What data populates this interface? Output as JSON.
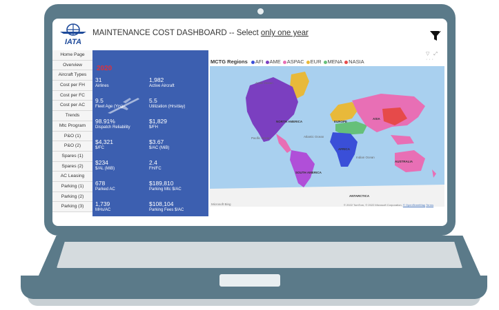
{
  "header": {
    "logo_text": "IATA",
    "title_prefix": "MAINTENANCE COST DASHBOARD -- Select ",
    "title_emphasis": "only one year"
  },
  "nav": [
    "Home Page",
    "Overview",
    "Aircraft Types",
    "Cost per FH",
    "Cost per FC",
    "Cost per AC",
    "Trends",
    "Mtc Program",
    "P&O (1)",
    "P&O (2)",
    "Spares (1)",
    "Spares (2)",
    "AC Leasing",
    "Parking (1)",
    "Parking (2)",
    "Parking (3)"
  ],
  "kpis": {
    "year": "2020",
    "items": [
      {
        "value": "31",
        "label": "Airlines"
      },
      {
        "value": "1,982",
        "label": "Active Aircraft"
      },
      {
        "value": "9.5",
        "label": "Fleet Age (Yrs)"
      },
      {
        "value": "5.5",
        "label": "Utilization (Hrs/day)"
      },
      {
        "value": "98.91%",
        "label": "Dispatch Reliability"
      },
      {
        "value": "$1,829",
        "label": "$/FH"
      },
      {
        "value": "$4,321",
        "label": "$/FC"
      },
      {
        "value": "$3.67",
        "label": "$/AC (MiB)"
      },
      {
        "value": "$234",
        "label": "$/AL (MiB)"
      },
      {
        "value": "2.4",
        "label": "FH/FC"
      },
      {
        "value": "678",
        "label": "Parked AC"
      },
      {
        "value": "$189,810",
        "label": "Parking Mtc $/AC"
      },
      {
        "value": "1,739",
        "label": "MHs/AC"
      },
      {
        "value": "$108,104",
        "label": "Parking Fees $/AC"
      }
    ]
  },
  "map": {
    "legend_title": "MCTG Regions",
    "regions": [
      {
        "name": "AFI",
        "color": "#3a4fd8"
      },
      {
        "name": "AME",
        "color": "#7b3fc0"
      },
      {
        "name": "ASPAC",
        "color": "#e86fb5"
      },
      {
        "name": "EUR",
        "color": "#e8b93a"
      },
      {
        "name": "MENA",
        "color": "#66c07a"
      },
      {
        "name": "NASIA",
        "color": "#e64a4a"
      }
    ],
    "labels": {
      "north_america": "NORTH AMERICA",
      "south_america": "SOUTH AMERICA",
      "europe": "EUROPE",
      "asia": "ASIA",
      "africa": "AFRICA",
      "australia": "AUSTRALIA",
      "antarctica": "ANTARCTICA",
      "arctic_ocean": "Arctic Ocean",
      "pacific_ocean": "Pacific Ocean",
      "atlantic_ocean": "Atlantic Ocean",
      "indian_ocean": "Indian Ocean"
    },
    "provider": "Microsoft Bing",
    "credit_prefix": "© 2022 TomTom, © 2022 Microsoft Corporation, ",
    "credit_osm": "© OpenStreetMap",
    "credit_terms": "Terms"
  }
}
